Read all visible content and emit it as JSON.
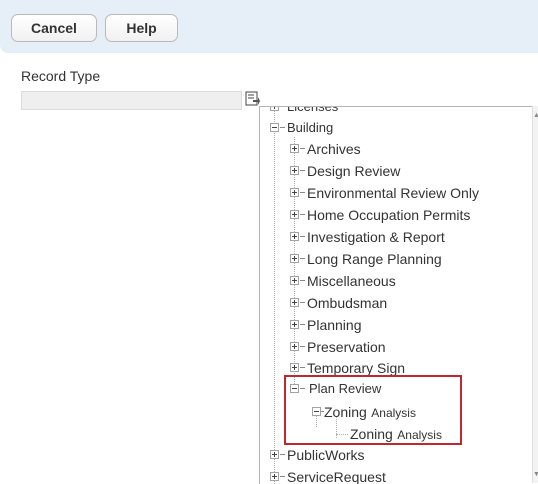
{
  "toolbar": {
    "cancel_label": "Cancel",
    "help_label": "Help"
  },
  "record_type": {
    "label": "Record Type",
    "value": ""
  },
  "tree": {
    "top_partial": "Licenses",
    "building": {
      "label": "Building",
      "children": [
        "Archives",
        "Design Review",
        "Environmental Review Only",
        "Home Occupation Permits",
        "Investigation & Report",
        "Long Range Planning",
        "Miscellaneous",
        "Ombudsman",
        "Planning",
        "Preservation",
        "Temporary Sign"
      ],
      "plan_review": {
        "label": "Plan Review",
        "zoning_parent": {
          "main": "Zoning",
          "sub": "Analysis"
        },
        "zoning_child": {
          "main": "Zoning",
          "sub": "Analysis"
        }
      }
    },
    "after": [
      "PublicWorks",
      "ServiceRequest"
    ]
  }
}
